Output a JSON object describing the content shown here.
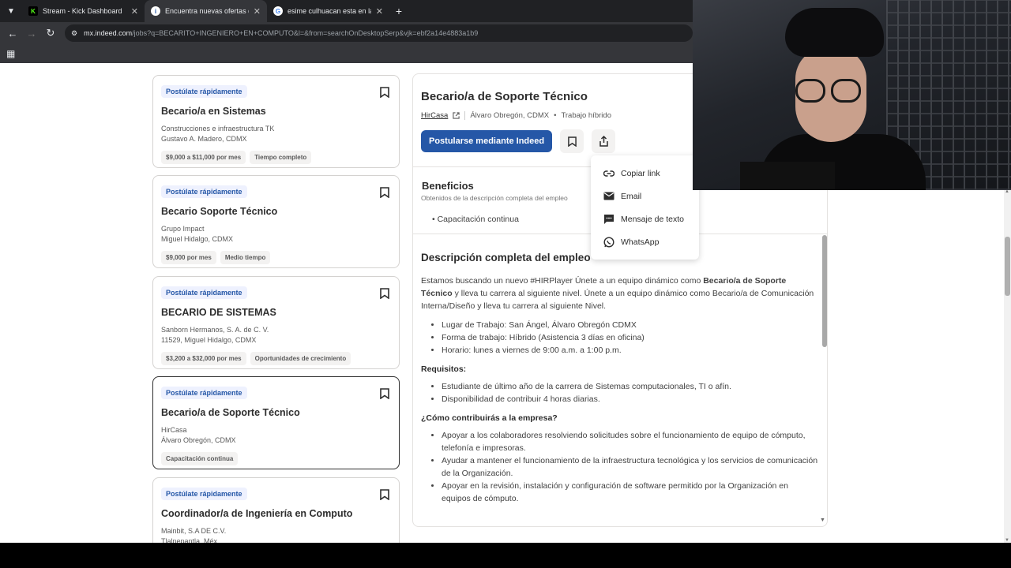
{
  "browser": {
    "tabs": [
      {
        "title": "Stream - Kick Dashboard",
        "favicon": "K",
        "favicon_color": "#53fc18"
      },
      {
        "title": "Encuentra nuevas ofertas de Be",
        "favicon": "i",
        "favicon_color": "#ffffff",
        "active": true
      },
      {
        "title": "esime culhuacan esta en la mig",
        "favicon": "G",
        "favicon_color": "#ffffff"
      }
    ],
    "url_host": "mx.indeed.com",
    "url_path": "/jobs?q=BECARITO+INGENIERO+EN+COMPUTO&l=&from=searchOnDesktopSerp&vjk=ebf2a14e4883a1b9"
  },
  "job_cards": [
    {
      "badge": "Postúlate rápidamente",
      "title": "Becario/a en Sistemas",
      "company": "Construcciones e infraestructura TK",
      "location": "Gustavo A. Madero, CDMX",
      "tags": [
        "$9,000 a $11,000 por mes",
        "Tiempo completo"
      ]
    },
    {
      "badge": "Postúlate rápidamente",
      "title": "Becario Soporte Técnico",
      "company": "Grupo Impact",
      "location": "Miguel Hidalgo, CDMX",
      "tags": [
        "$9,000 por mes",
        "Medio tiempo"
      ]
    },
    {
      "badge": "Postúlate rápidamente",
      "title": "BECARIO DE SISTEMAS",
      "company": "Sanborn Hermanos, S. A. de C. V.",
      "location": "11529, Miguel Hidalgo, CDMX",
      "tags": [
        "$3,200 a $32,000 por mes",
        "Oportunidades de crecimiento"
      ]
    },
    {
      "badge": "Postúlate rápidamente",
      "title": "Becario/a de Soporte Técnico",
      "company": "HirCasa",
      "location": "Álvaro Obregón, CDMX",
      "tags": [
        "Capacitación continua"
      ],
      "selected": true
    },
    {
      "badge": "Postúlate rápidamente",
      "title": "Coordinador/a de Ingeniería en Computo",
      "company": "Mainbit, S.A DE C.V.",
      "location": "Tlalnepantla, Méx.",
      "tags": []
    }
  ],
  "detail": {
    "title": "Becario/a de Soporte Técnico",
    "company": "HirCasa",
    "location": "Álvaro Obregón, CDMX",
    "work_mode": "Trabajo híbrido",
    "apply_label": "Postularse mediante Indeed",
    "benefits_title": "Beneficios",
    "benefits_subtitle": "Obtenidos de la descripción completa del empleo",
    "benefits": [
      "Capacitación continua"
    ],
    "description_title": "Descripción completa del empleo",
    "intro_start": "Estamos buscando un nuevo #HIRPlayer Únete a un equipo dinámico como ",
    "intro_bold": "Becario/a de Soporte Técnico",
    "intro_end": " y lleva tu carrera al siguiente nivel. Únete a un equipo dinámico como Becario/a de Comunicación Interna/Diseño y lleva tu carrera al siguiente Nivel.",
    "details_list": [
      "Lugar de Trabajo: San Ángel, Álvaro Obregón CDMX",
      "Forma de trabajo: Híbrido (Asistencia 3 días en oficina)",
      "Horario: lunes a viernes de 9:00 a.m. a 1:00 p.m."
    ],
    "requirements_title": "Requisitos:",
    "requirements": [
      "Estudiante de último año de la carrera de Sistemas computacionales, TI o afín.",
      "Disponibilidad de contribuir 4 horas diarias."
    ],
    "contribution_title": "¿Cómo contribuirás a la empresa?",
    "contributions": [
      "Apoyar a los colaboradores resolviendo solicitudes sobre el funcionamiento de equipo de cómputo, telefonía e impresoras.",
      "Ayudar a mantener el funcionamiento de la infraestructura tecnológica y los servicios de comunicación de la Organización.",
      "Apoyar en la revisión, instalación y configuración de software permitido por la Organización en equipos de cómputo."
    ]
  },
  "share_menu": {
    "items": [
      {
        "label": "Copiar link",
        "icon": "link-icon"
      },
      {
        "label": "Email",
        "icon": "email-icon"
      },
      {
        "label": "Mensaje de texto",
        "icon": "message-icon"
      },
      {
        "label": "WhatsApp",
        "icon": "whatsapp-icon"
      }
    ]
  },
  "colors": {
    "accent": "#2557a7",
    "badge_bg": "#eef1fe",
    "chrome_dark": "#202124"
  }
}
